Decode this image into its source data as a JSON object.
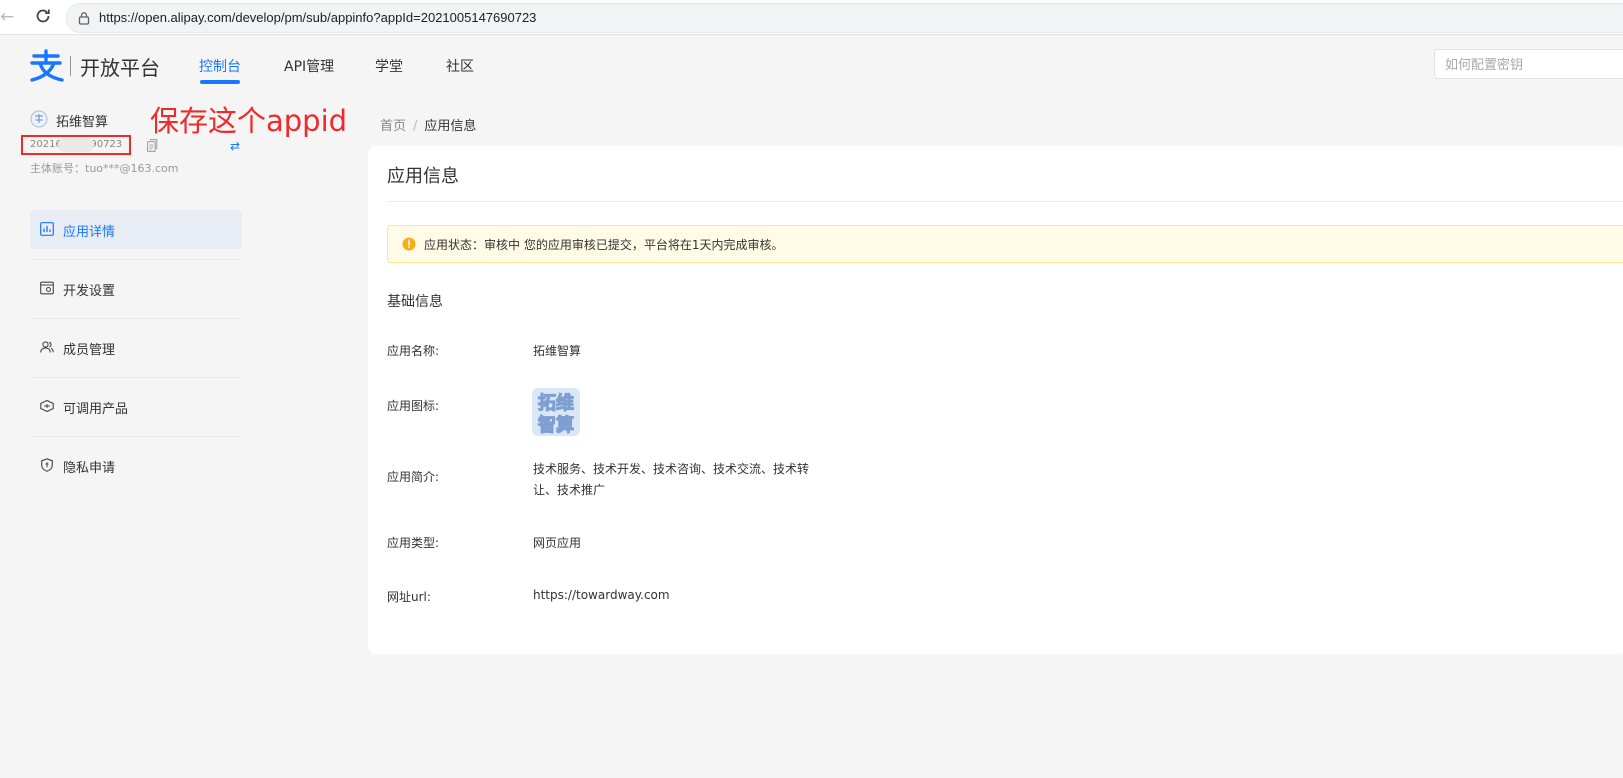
{
  "browser": {
    "url": "https://open.alipay.com/develop/pm/sub/appinfo?appId=2021005147690723"
  },
  "header": {
    "logo_text": "开放平台",
    "nav": [
      {
        "label": "控制台",
        "active": true
      },
      {
        "label": "API管理",
        "active": false
      },
      {
        "label": "学堂",
        "active": false
      },
      {
        "label": "社区",
        "active": false
      }
    ],
    "search_placeholder": "如何配置密钥"
  },
  "sidebar": {
    "app_name": "拓维智算",
    "app_id_visible_start": "20216",
    "app_id_visible_end": "690723",
    "annotation": "保存这个appid",
    "account": "主体账号：tuo***@163.com",
    "items": [
      {
        "label": "应用详情",
        "icon": "bar-chart-icon",
        "active": true
      },
      {
        "label": "开发设置",
        "icon": "settings-card-icon",
        "active": false
      },
      {
        "label": "成员管理",
        "icon": "members-icon",
        "active": false
      },
      {
        "label": "可调用产品",
        "icon": "products-icon",
        "active": false
      },
      {
        "label": "隐私申请",
        "icon": "shield-icon",
        "active": false
      }
    ]
  },
  "breadcrumb": {
    "home": "首页",
    "separator": "/",
    "current": "应用信息"
  },
  "main": {
    "title": "应用信息",
    "alert": "应用状态：审核中 您的应用审核已提交，平台将在1天内完成审核。",
    "section_title": "基础信息",
    "fields": {
      "name_label": "应用名称:",
      "name_value": "拓维智算",
      "icon_label": "应用图标:",
      "icon_text_line1": "拓维",
      "icon_text_line2": "智算",
      "desc_label": "应用简介:",
      "desc_value": "技术服务、技术开发、技术咨询、技术交流、技术转让、技术推广",
      "type_label": "应用类型:",
      "type_value": "网页应用",
      "url_label": "网址url:",
      "url_value": "https://towardway.com"
    }
  },
  "colors": {
    "accent": "#1677ff",
    "annotation_red": "#ee2a2a",
    "alert_bg": "#fffbe6",
    "alert_border": "#ffe58f",
    "alert_icon": "#faad14"
  }
}
